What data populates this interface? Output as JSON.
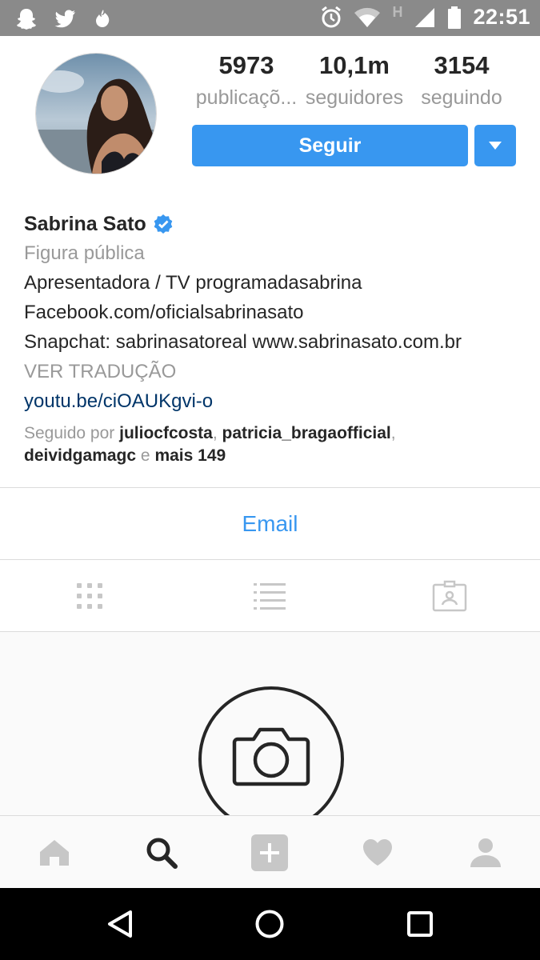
{
  "status_bar": {
    "time": "22:51",
    "network_label": "H",
    "icons": [
      "snapchat-icon",
      "twitter-icon",
      "tinder-icon",
      "alarm-icon",
      "wifi-icon",
      "signal-icon",
      "battery-icon"
    ]
  },
  "profile": {
    "stats": [
      {
        "value": "5973",
        "label": "publicaçõ..."
      },
      {
        "value": "10,1m",
        "label": "seguidores"
      },
      {
        "value": "3154",
        "label": "seguindo"
      }
    ],
    "follow_label": "Seguir",
    "name": "Sabrina Sato",
    "category": "Figura pública",
    "bio_lines": [
      "Apresentadora / TV programadasabrina",
      "Facebook.com/oficialsabrinasato",
      "Snapchat: sabrinasatoreal www.sabrinasato.com.br"
    ],
    "translate_label": "VER TRADUÇÃO",
    "link": "youtu.be/ciOAUKgvi-o",
    "followed_by": {
      "prefix": "Seguido por",
      "user1": "juliocfcosta",
      "sep1": ",",
      "user2": "patricia_bragaofficial",
      "sep2": ",",
      "user3": "deividgamagc",
      "and": "e",
      "more": "mais 149"
    },
    "email_label": "Email"
  },
  "colors": {
    "accent": "#3897f0",
    "text": "#262626",
    "muted": "#999999",
    "link": "#003569",
    "status_bar": "#8a8a8a"
  }
}
